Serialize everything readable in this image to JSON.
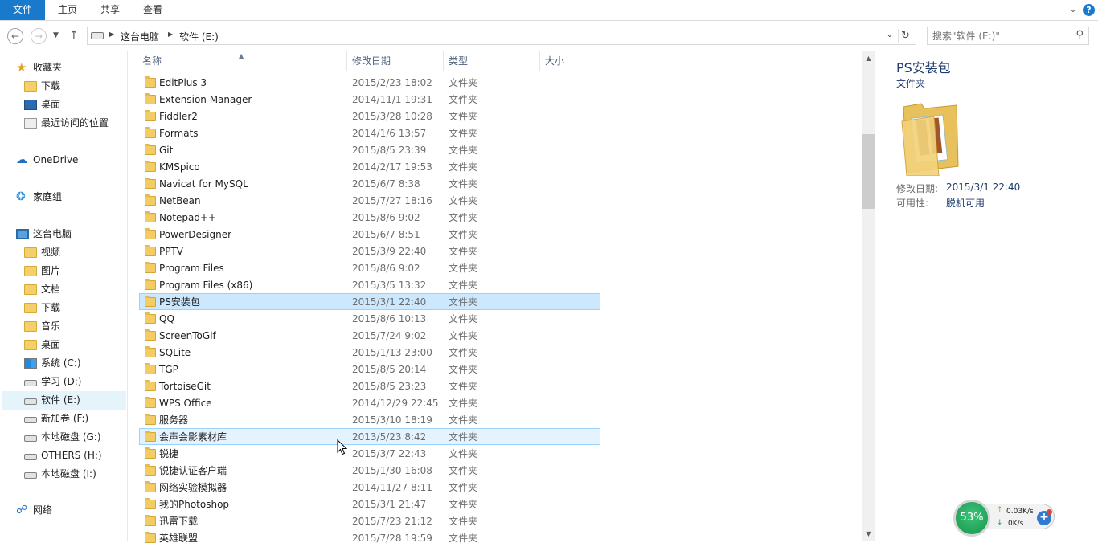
{
  "ribbon": {
    "file_tab": "文件",
    "tabs": [
      "主页",
      "共享",
      "查看"
    ],
    "help": "?"
  },
  "address": {
    "crumbs": [
      "这台电脑",
      "软件 (E:)"
    ],
    "search_placeholder": "搜索\"软件 (E:)\""
  },
  "nav": {
    "favorites": {
      "label": "收藏夹",
      "items": [
        "下载",
        "桌面",
        "最近访问的位置"
      ]
    },
    "onedrive": "OneDrive",
    "homegroup": "家庭组",
    "thispc": {
      "label": "这台电脑",
      "items": [
        "视频",
        "图片",
        "文档",
        "下载",
        "音乐",
        "桌面",
        "系统 (C:)",
        "学习 (D:)",
        "软件 (E:)",
        "新加卷 (F:)",
        "本地磁盘 (G:)",
        "OTHERS (H:)",
        "本地磁盘 (I:)"
      ]
    },
    "network": "网络"
  },
  "columns": {
    "name": "名称",
    "date": "修改日期",
    "type": "类型",
    "size": "大小"
  },
  "files": [
    {
      "name": "EditPlus 3",
      "date": "2015/2/23 18:02",
      "type": "文件夹"
    },
    {
      "name": "Extension Manager",
      "date": "2014/11/1 19:31",
      "type": "文件夹"
    },
    {
      "name": "Fiddler2",
      "date": "2015/3/28 10:28",
      "type": "文件夹"
    },
    {
      "name": "Formats",
      "date": "2014/1/6 13:57",
      "type": "文件夹"
    },
    {
      "name": "Git",
      "date": "2015/8/5 23:39",
      "type": "文件夹"
    },
    {
      "name": "KMSpico",
      "date": "2014/2/17 19:53",
      "type": "文件夹"
    },
    {
      "name": "Navicat for MySQL",
      "date": "2015/6/7 8:38",
      "type": "文件夹"
    },
    {
      "name": "NetBean",
      "date": "2015/7/27 18:16",
      "type": "文件夹"
    },
    {
      "name": "Notepad++",
      "date": "2015/8/6 9:02",
      "type": "文件夹"
    },
    {
      "name": "PowerDesigner",
      "date": "2015/6/7 8:51",
      "type": "文件夹"
    },
    {
      "name": "PPTV",
      "date": "2015/3/9 22:40",
      "type": "文件夹"
    },
    {
      "name": "Program Files",
      "date": "2015/8/6 9:02",
      "type": "文件夹"
    },
    {
      "name": "Program Files (x86)",
      "date": "2015/3/5 13:32",
      "type": "文件夹"
    },
    {
      "name": "PS安装包",
      "date": "2015/3/1 22:40",
      "type": "文件夹"
    },
    {
      "name": "QQ",
      "date": "2015/8/6 10:13",
      "type": "文件夹"
    },
    {
      "name": "ScreenToGif",
      "date": "2015/7/24 9:02",
      "type": "文件夹"
    },
    {
      "name": "SQLite",
      "date": "2015/1/13 23:00",
      "type": "文件夹"
    },
    {
      "name": "TGP",
      "date": "2015/8/5 20:14",
      "type": "文件夹"
    },
    {
      "name": "TortoiseGit",
      "date": "2015/8/5 23:23",
      "type": "文件夹"
    },
    {
      "name": "WPS Office",
      "date": "2014/12/29 22:45",
      "type": "文件夹"
    },
    {
      "name": "服务器",
      "date": "2015/3/10 18:19",
      "type": "文件夹"
    },
    {
      "name": "会声会影素材库",
      "date": "2013/5/23 8:42",
      "type": "文件夹"
    },
    {
      "name": "锐捷",
      "date": "2015/3/7 22:43",
      "type": "文件夹"
    },
    {
      "name": "锐捷认证客户端",
      "date": "2015/1/30 16:08",
      "type": "文件夹"
    },
    {
      "name": "网络实验模拟器",
      "date": "2014/11/27 8:11",
      "type": "文件夹"
    },
    {
      "name": "我的Photoshop",
      "date": "2015/3/1 21:47",
      "type": "文件夹"
    },
    {
      "name": "迅雷下载",
      "date": "2015/7/23 21:12",
      "type": "文件夹"
    },
    {
      "name": "英雄联盟",
      "date": "2015/7/28 19:59",
      "type": "文件夹"
    }
  ],
  "details": {
    "title": "PS安装包",
    "kind": "文件夹",
    "modified_label": "修改日期:",
    "modified_value": "2015/3/1 22:40",
    "availability_label": "可用性:",
    "availability_value": "脱机可用"
  },
  "netwidget": {
    "percent": "53%",
    "up": "0.03K/s",
    "down": "0K/s"
  },
  "colors": {
    "accent": "#1979ca",
    "selection": "#cce8ff",
    "folder": "#f3cd63"
  }
}
